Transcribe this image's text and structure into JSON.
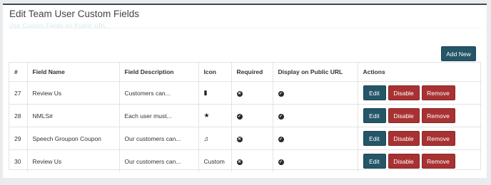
{
  "page": {
    "title": "Edit Team User Custom Fields",
    "subtitle_link": "Use Custom Fields on Public URL"
  },
  "toolbar": {
    "add_new_label": "Add New"
  },
  "table": {
    "headers": [
      "#",
      "Field Name",
      "Field Description",
      "Icon",
      "Required",
      "Display on Public URL",
      "Actions"
    ],
    "rows": [
      {
        "id": "27",
        "name": "Review Us",
        "description": "Customers can...",
        "icon": "id-badge-icon",
        "icon_text": "",
        "required": "x",
        "display": "check"
      },
      {
        "id": "28",
        "name": "NMLS#",
        "description": "Each user must...",
        "icon": "star-icon",
        "icon_text": "",
        "required": "check",
        "display": "check"
      },
      {
        "id": "29",
        "name": "Speech Groupon Coupon",
        "description": "Our customers can...",
        "icon": "music-icon",
        "icon_text": "",
        "required": "x",
        "display": "check"
      },
      {
        "id": "30",
        "name": "Review Us",
        "description": "Our customers can...",
        "icon": "",
        "icon_text": "Custom",
        "required": "x",
        "display": "check"
      }
    ],
    "actions": {
      "edit": "Edit",
      "disable": "Disable",
      "remove": "Remove"
    }
  },
  "colors": {
    "primary": "#245667",
    "danger": "#a83232"
  }
}
